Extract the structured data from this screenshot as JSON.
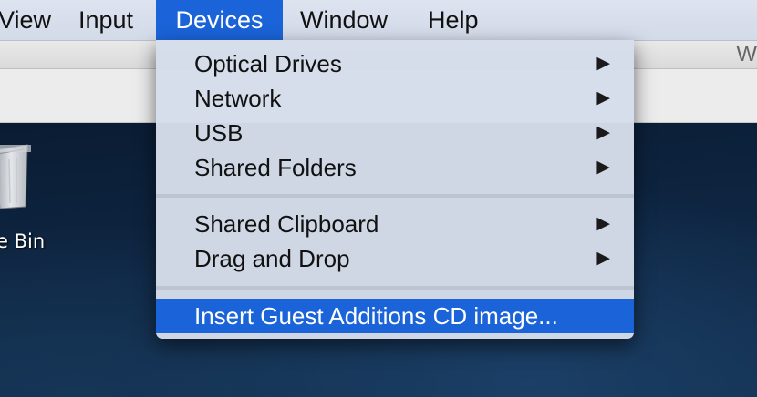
{
  "menubar": {
    "items": [
      {
        "label": "View"
      },
      {
        "label": "Input"
      },
      {
        "label": "Devices"
      },
      {
        "label": "Window"
      },
      {
        "label": "Help"
      }
    ]
  },
  "window": {
    "title_fragment": "W"
  },
  "desktop": {
    "recycle_bin_label": "e Bin"
  },
  "devices_menu": {
    "items": [
      {
        "label": "Optical Drives",
        "submenu_arrow": "▶"
      },
      {
        "label": "Network",
        "submenu_arrow": "▶"
      },
      {
        "label": "USB",
        "submenu_arrow": "▶"
      },
      {
        "label": "Shared Folders",
        "submenu_arrow": "▶"
      },
      {
        "label": "Shared Clipboard",
        "submenu_arrow": "▶"
      },
      {
        "label": "Drag and Drop",
        "submenu_arrow": "▶"
      },
      {
        "label": "Insert Guest Additions CD image..."
      }
    ]
  },
  "colors": {
    "accent": "#1a63d8",
    "menu_background": "#d6ddea",
    "desktop_background": "#0f2744"
  }
}
